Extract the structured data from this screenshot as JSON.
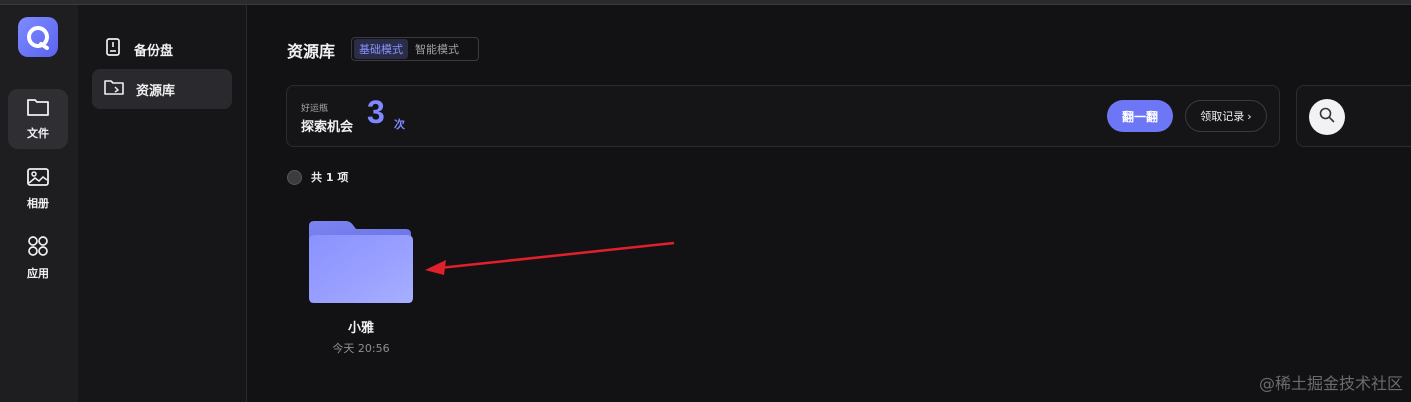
{
  "rail": {
    "items": [
      {
        "label": "文件",
        "icon": "folder-icon"
      },
      {
        "label": "相册",
        "icon": "photo-icon"
      },
      {
        "label": "应用",
        "icon": "apps-grid-icon"
      }
    ]
  },
  "sidebar": {
    "items": [
      {
        "label": "备份盘",
        "icon": "backup-disk-icon"
      },
      {
        "label": "资源库",
        "icon": "resource-folder-icon"
      }
    ]
  },
  "header": {
    "title": "资源库",
    "modes": [
      "基础模式",
      "智能模式"
    ]
  },
  "luck": {
    "small_label": "好运瓶",
    "main_label": "探索机会",
    "count": "3",
    "unit": "次",
    "flip_label": "翻一翻",
    "record_label": "领取记录",
    "record_chevron": "›"
  },
  "listing": {
    "count_text": "共 1 项"
  },
  "folder": {
    "name": "小雅",
    "time": "今天 20:56"
  },
  "watermark": "@稀土掘金技术社区",
  "colors": {
    "accent": "#6d77f5",
    "arrow": "#e0202a"
  }
}
